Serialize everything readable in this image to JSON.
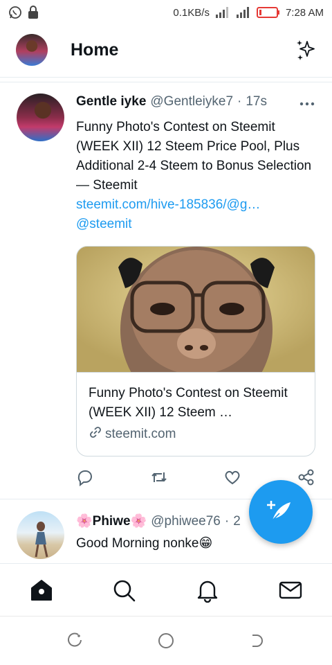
{
  "status_bar": {
    "net_speed": "0.1KB/s",
    "time": "7:28 AM",
    "icons": [
      "whatsapp-icon",
      "lock-icon",
      "signal-icon",
      "signal-4g-icon",
      "battery-low-icon"
    ]
  },
  "header": {
    "title": "Home",
    "icons": [
      "avatar",
      "sparkle-icon"
    ]
  },
  "tweets": [
    {
      "name": "Gentle iyke",
      "handle": "@Gentleiyke7",
      "dot": "·",
      "time": "17s",
      "text": "Funny Photo's Contest on Steemit (WEEK XII) 12 Steem Price Pool, Plus Additional 2-4 Steem to Bonus Selection — Steemit",
      "link": "steemit.com/hive-185836/@g…",
      "mention": "@steemit",
      "card": {
        "title": "Funny Photo's Contest on Steemit (WEEK XII) 12 Steem …",
        "domain": "steemit.com"
      }
    },
    {
      "name": "🌸Phiwe🌸",
      "handle": "@phiwee76",
      "dot": "·",
      "time": "2",
      "text": "Good Morning nonke😁"
    }
  ],
  "actions": [
    "reply-icon",
    "retweet-icon",
    "like-icon",
    "share-icon"
  ],
  "bottom_nav": [
    "home-icon",
    "search-icon",
    "notifications-icon",
    "messages-icon"
  ],
  "system_nav": [
    "recent-apps-icon",
    "home-button-icon",
    "back-icon"
  ],
  "colors": {
    "accent": "#1d9bf0",
    "text": "#0f1419",
    "secondary": "#536471",
    "battery": "#e53935"
  }
}
